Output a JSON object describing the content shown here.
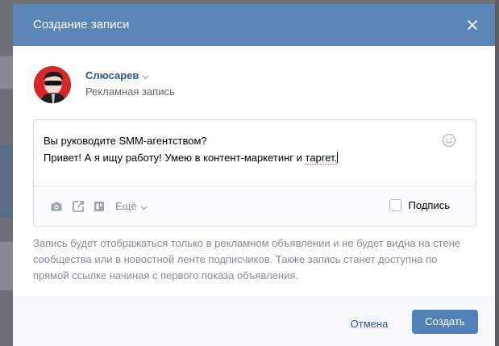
{
  "modal": {
    "title": "Создание записи"
  },
  "author": {
    "name": "Слюсарев",
    "subtitle": "Рекламная запись"
  },
  "editor": {
    "line1": "Вы руководите SMM-агентством?",
    "line2_prefix": "Привет! А я ищу работу! Умею в контент-маркетинг и ",
    "line2_misspelled": "таргет."
  },
  "toolbar": {
    "more_label": "Ещё",
    "sign_label": "Подпись",
    "sign_checked": false
  },
  "notice": "Запись будет отображаться только в рекламном объявлении и не будет видна на стене сообщества или в новостной ленте подписчиков. Также запись станет доступна по прямой ссылке начиная с первого показа объявления.",
  "footer": {
    "cancel_label": "Отмена",
    "create_label": "Создать"
  },
  "colors": {
    "header": "#5b85b6",
    "primary_button": "#5181b8",
    "link": "#2a5885",
    "muted": "#828a99"
  }
}
